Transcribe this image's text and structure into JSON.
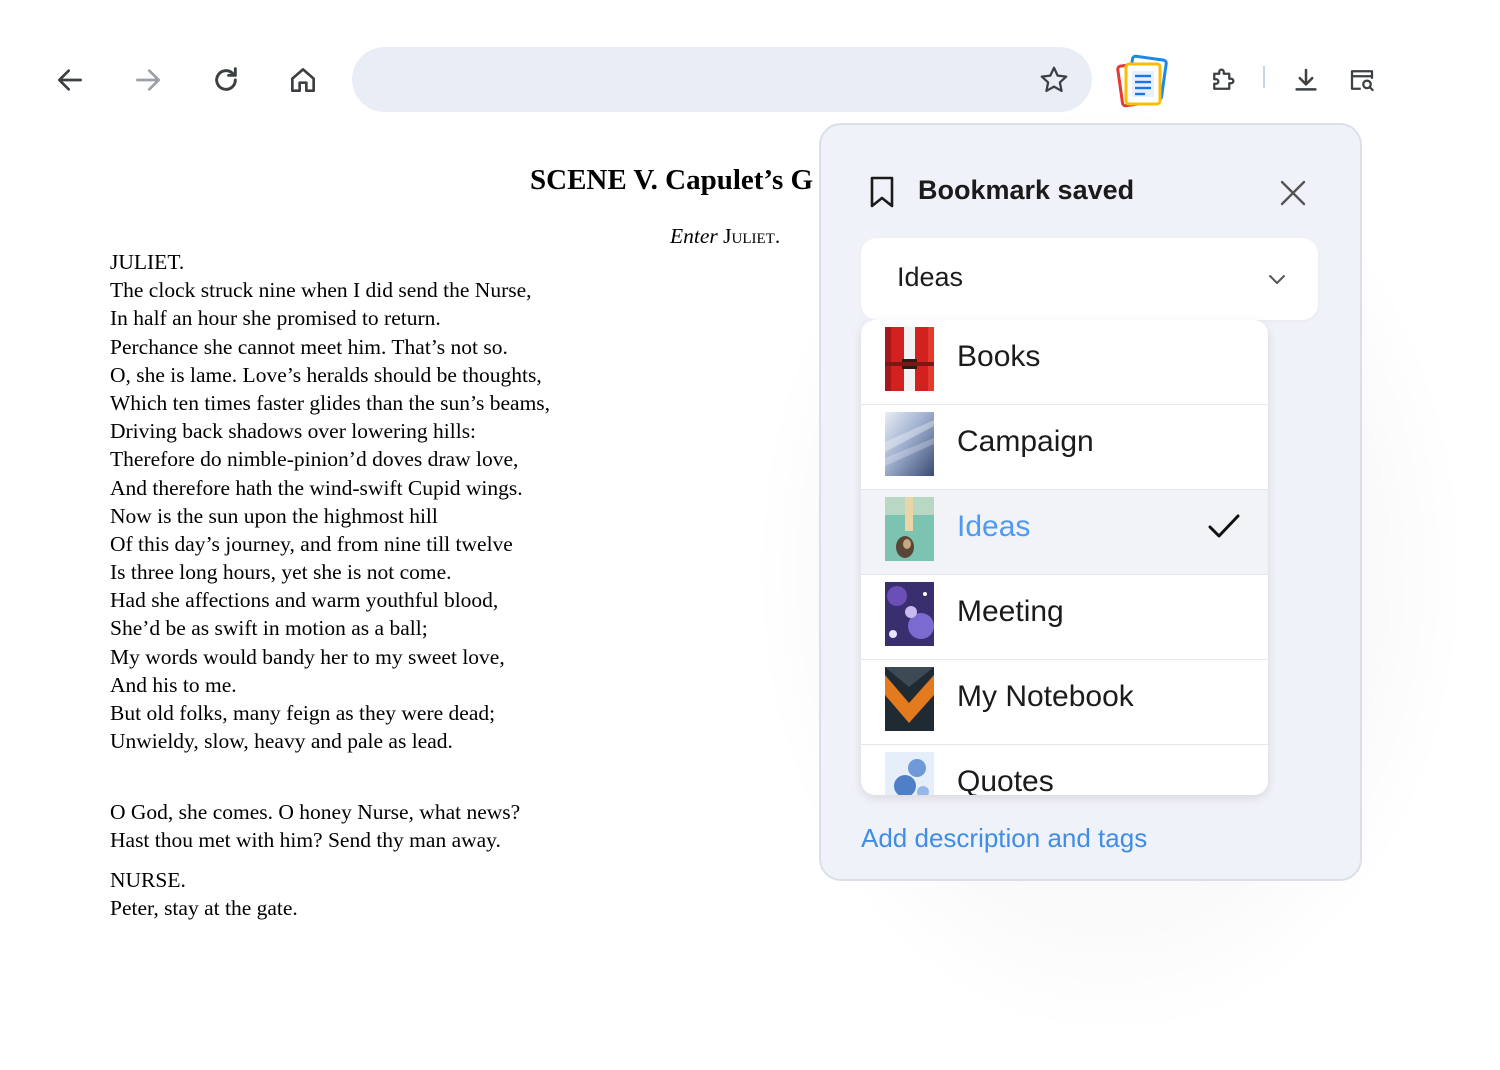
{
  "toolbar": {
    "address_value": "",
    "icons": [
      "back-arrow-icon",
      "forward-arrow-icon",
      "reload-icon",
      "home-icon",
      "star-icon",
      "notes-app-icon",
      "puzzle-icon",
      "download-icon",
      "side-panel-search-icon"
    ]
  },
  "document": {
    "scene_title": "SCENE V. Capulet’s G",
    "stage_direction_italic": "Enter",
    "stage_direction_name": "Juliet",
    "speeches": [
      {
        "speaker": "JULIET.",
        "lines": [
          "The clock struck nine when I did send the Nurse,",
          "In half an hour she promised to return.",
          "Perchance she cannot meet him. That’s not so.",
          "O, she is lame. Love’s heralds should be thoughts,",
          "Which ten times faster glides than the sun’s beams,",
          "Driving back shadows over lowering hills:",
          "Therefore do nimble-pinion’d doves draw love,",
          "And therefore hath the wind-swift Cupid wings.",
          "Now is the sun upon the highmost hill",
          "Of this day’s journey, and from nine till twelve",
          "Is three long hours, yet she is not come.",
          "Had she affections and warm youthful blood,",
          "She’d be as swift in motion as a ball;",
          "My words would bandy her to my sweet love,",
          "And his to me.",
          "But old folks, many feign as they were dead;",
          "Unwieldy, slow, heavy and pale as lead."
        ]
      },
      {
        "speaker": "",
        "lines": [
          "O God, she comes. O honey Nurse, what news?",
          "Hast thou met with him? Send thy man away."
        ]
      },
      {
        "speaker": "NURSE.",
        "lines": [
          "Peter, stay at the gate."
        ]
      }
    ]
  },
  "popup": {
    "title": "Bookmark saved",
    "selected_folder": "Ideas",
    "folders": [
      {
        "label": "Books",
        "selected": false,
        "thumb": "red-book-thumbnail"
      },
      {
        "label": "Campaign",
        "selected": false,
        "thumb": "blue-gradient-thumbnail"
      },
      {
        "label": "Ideas",
        "selected": true,
        "thumb": "teal-painting-thumbnail"
      },
      {
        "label": "Meeting",
        "selected": false,
        "thumb": "purple-space-thumbnail"
      },
      {
        "label": "My Notebook",
        "selected": false,
        "thumb": "orange-chevron-thumbnail"
      },
      {
        "label": "Quotes",
        "selected": false,
        "thumb": "blue-bubbles-thumbnail"
      }
    ],
    "add_description_label": "Add description and tags",
    "colors": {
      "popup_bg": "#eff2f8",
      "selected_label": "#4f98f3",
      "link": "#3f8de6",
      "omnibox_bg": "#e9eef6"
    }
  }
}
